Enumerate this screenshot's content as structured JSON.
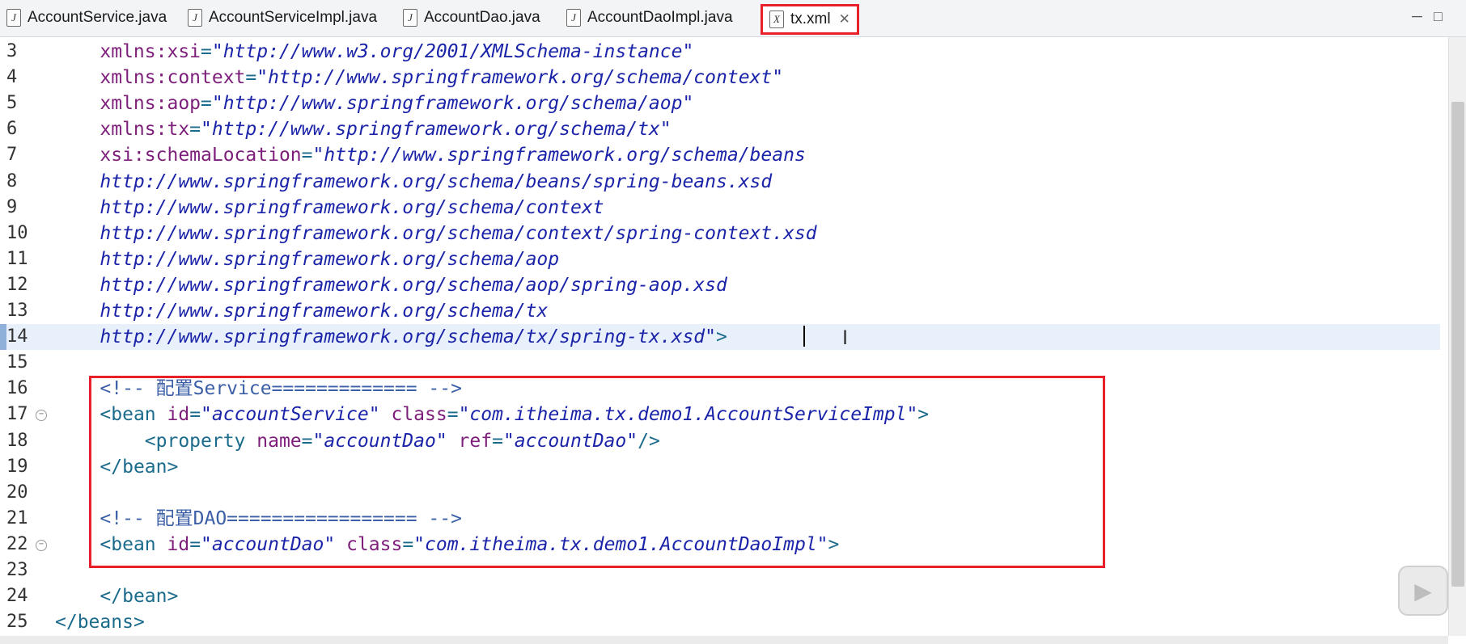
{
  "tabs": [
    {
      "label": "AccountService.java",
      "icon": "java-file-icon",
      "active": false
    },
    {
      "label": "AccountServiceImpl.java",
      "icon": "java-file-icon",
      "active": false
    },
    {
      "label": "AccountDao.java",
      "icon": "java-file-icon",
      "active": false
    },
    {
      "label": "AccountDaoImpl.java",
      "icon": "java-file-icon",
      "active": false
    },
    {
      "label": "tx.xml",
      "icon": "xml-file-icon",
      "active": true
    }
  ],
  "window_controls": {
    "minimize": "─",
    "maximize": "□"
  },
  "lines": [
    {
      "n": "3",
      "parts": [
        [
          "attr",
          "    xmlns:xsi"
        ],
        [
          "punct",
          "="
        ],
        [
          "val",
          "\"http://www.w3.org/2001/XMLSchema-instance\""
        ]
      ]
    },
    {
      "n": "4",
      "parts": [
        [
          "attr",
          "    xmlns:context"
        ],
        [
          "punct",
          "="
        ],
        [
          "val",
          "\"http://www.springframework.org/schema/context\""
        ]
      ]
    },
    {
      "n": "5",
      "parts": [
        [
          "attr",
          "    xmlns:aop"
        ],
        [
          "punct",
          "="
        ],
        [
          "val",
          "\"http://www.springframework.org/schema/aop\""
        ]
      ]
    },
    {
      "n": "6",
      "parts": [
        [
          "attr",
          "    xmlns:tx"
        ],
        [
          "punct",
          "="
        ],
        [
          "val",
          "\"http://www.springframework.org/schema/tx\""
        ]
      ]
    },
    {
      "n": "7",
      "parts": [
        [
          "attr",
          "    xsi:schemaLocation"
        ],
        [
          "punct",
          "="
        ],
        [
          "val",
          "\"http://www.springframework.org/schema/beans"
        ]
      ]
    },
    {
      "n": "8",
      "parts": [
        [
          "val",
          "    http://www.springframework.org/schema/beans/spring-beans.xsd"
        ]
      ]
    },
    {
      "n": "9",
      "parts": [
        [
          "val",
          "    http://www.springframework.org/schema/context"
        ]
      ]
    },
    {
      "n": "10",
      "parts": [
        [
          "val",
          "    http://www.springframework.org/schema/context/spring-context.xsd"
        ]
      ]
    },
    {
      "n": "11",
      "parts": [
        [
          "val",
          "    http://www.springframework.org/schema/aop"
        ]
      ]
    },
    {
      "n": "12",
      "parts": [
        [
          "val",
          "    http://www.springframework.org/schema/aop/spring-aop.xsd"
        ]
      ]
    },
    {
      "n": "13",
      "parts": [
        [
          "val",
          "    http://www.springframework.org/schema/tx"
        ]
      ]
    },
    {
      "n": "14",
      "parts": [
        [
          "val",
          "    http://www.springframework.org/schema/tx/spring-tx.xsd\""
        ],
        [
          "punct",
          ">"
        ]
      ]
    },
    {
      "n": "15",
      "parts": []
    },
    {
      "n": "16",
      "parts": [
        [
          "cmt",
          "    <!-- 配置Service============= -->"
        ]
      ]
    },
    {
      "n": "17",
      "parts": [
        [
          "punct",
          "    <"
        ],
        [
          "tag",
          "bean"
        ],
        [
          "attr",
          " id"
        ],
        [
          "punct",
          "="
        ],
        [
          "val",
          "\"accountService\""
        ],
        [
          "attr",
          " class"
        ],
        [
          "punct",
          "="
        ],
        [
          "val",
          "\"com.itheima.tx.demo1.AccountServiceImpl\""
        ],
        [
          "punct",
          ">"
        ]
      ]
    },
    {
      "n": "18",
      "parts": [
        [
          "punct",
          "        <"
        ],
        [
          "tag",
          "property"
        ],
        [
          "attr",
          " name"
        ],
        [
          "punct",
          "="
        ],
        [
          "val",
          "\"accountDao\""
        ],
        [
          "attr",
          " ref"
        ],
        [
          "punct",
          "="
        ],
        [
          "val",
          "\"accountDao\""
        ],
        [
          "punct",
          "/>"
        ]
      ]
    },
    {
      "n": "19",
      "parts": [
        [
          "punct",
          "    </"
        ],
        [
          "tag",
          "bean"
        ],
        [
          "punct",
          ">"
        ]
      ]
    },
    {
      "n": "20",
      "parts": []
    },
    {
      "n": "21",
      "parts": [
        [
          "cmt",
          "    <!-- 配置DAO================= -->"
        ]
      ]
    },
    {
      "n": "22",
      "parts": [
        [
          "punct",
          "    <"
        ],
        [
          "tag",
          "bean"
        ],
        [
          "attr",
          " id"
        ],
        [
          "punct",
          "="
        ],
        [
          "val",
          "\"accountDao\""
        ],
        [
          "attr",
          " class"
        ],
        [
          "punct",
          "="
        ],
        [
          "val",
          "\"com.itheima.tx.demo1.AccountDaoImpl\""
        ],
        [
          "punct",
          ">"
        ]
      ]
    },
    {
      "n": "23",
      "parts": []
    },
    {
      "n": "24",
      "parts": [
        [
          "punct",
          "    </"
        ],
        [
          "tag",
          "bean"
        ],
        [
          "punct",
          ">"
        ]
      ]
    },
    {
      "n": "25",
      "parts": [
        [
          "punct",
          "</"
        ],
        [
          "tag",
          "beans"
        ],
        [
          "punct",
          ">"
        ]
      ]
    }
  ],
  "current_line": "14",
  "fold_lines": [
    "17",
    "22"
  ],
  "colors": {
    "highlight_box": "#e8202a",
    "attribute": "#7d1f7a",
    "value": "#1b24a8",
    "tag": "#1b6b8c"
  }
}
